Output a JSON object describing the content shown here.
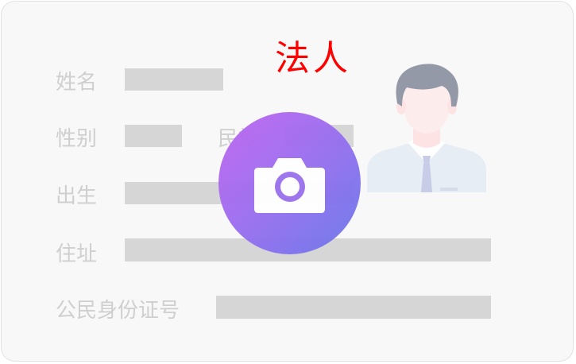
{
  "card": {
    "title": "法人",
    "fields": {
      "name_label": "姓名",
      "gender_label": "性别",
      "ethnicity_label": "民族",
      "birth_label": "出生",
      "address_label": "住址",
      "id_number_label": "公民身份证号"
    }
  },
  "icons": {
    "avatar": "person-avatar-icon",
    "camera": "camera-icon"
  },
  "colors": {
    "title": "#ff0000",
    "camera_gradient_start": "#c066f0",
    "camera_gradient_end": "#6a78ea",
    "placeholder_bar": "#d6d6d6",
    "label_text": "#cfcfcf"
  }
}
